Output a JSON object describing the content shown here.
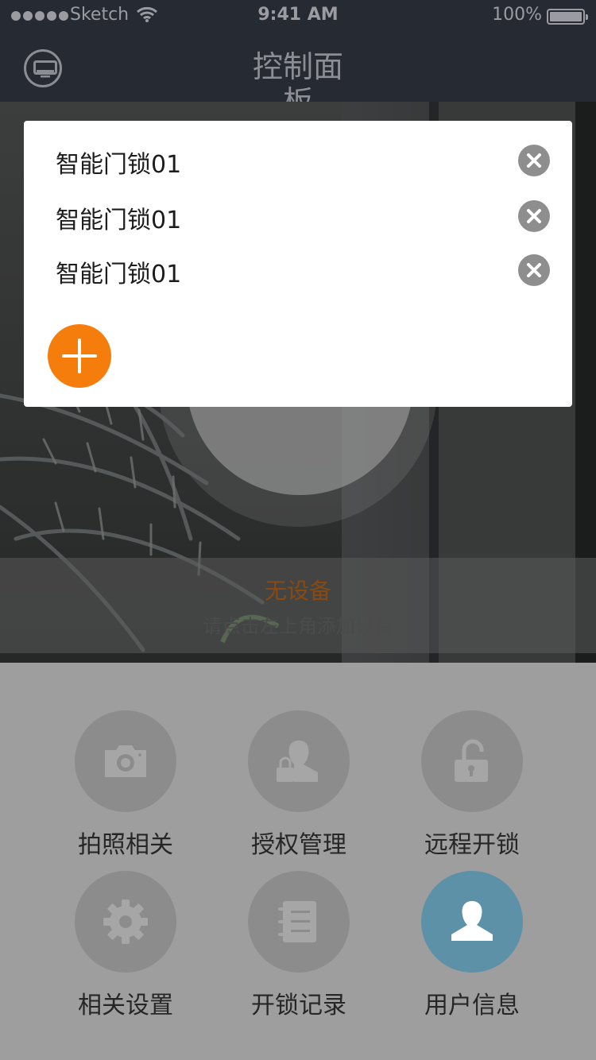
{
  "status_bar": {
    "carrier": "Sketch",
    "time": "9:41 AM",
    "battery": "100%"
  },
  "nav": {
    "title": "控制面板",
    "device_button_icon": "monitor-icon"
  },
  "popup": {
    "devices": [
      {
        "name": "智能门锁01",
        "remove_icon": "close-icon"
      },
      {
        "name": "智能门锁01",
        "remove_icon": "close-icon"
      },
      {
        "name": "智能门锁01",
        "remove_icon": "close-icon"
      }
    ],
    "add_icon": "plus-icon",
    "accent": "#f57d0c"
  },
  "info": {
    "title": "无设备",
    "subtitle": "请点击左上角添加设备"
  },
  "menu": {
    "items": [
      {
        "label": "拍照相关",
        "icon": "camera-icon"
      },
      {
        "label": "授权管理",
        "icon": "user-lock-icon"
      },
      {
        "label": "远程开锁",
        "icon": "unlock-icon"
      },
      {
        "label": "相关设置",
        "icon": "gear-icon"
      },
      {
        "label": "开锁记录",
        "icon": "notebook-icon"
      },
      {
        "label": "用户信息",
        "icon": "user-icon"
      }
    ],
    "user_color": "#5c91a8"
  }
}
